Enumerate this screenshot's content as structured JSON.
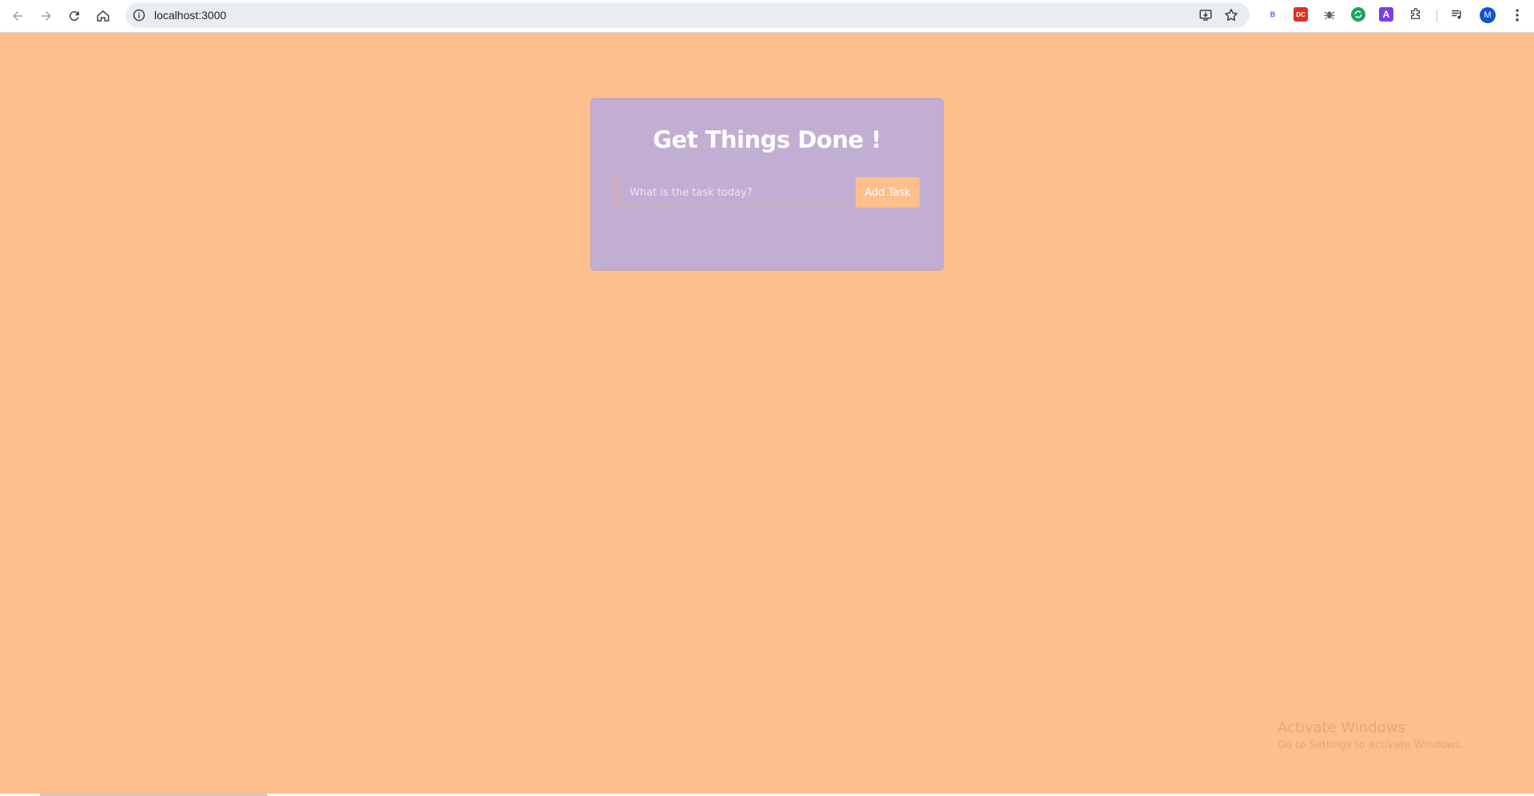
{
  "browser": {
    "url": "localhost:3000",
    "extensions": {
      "b": "B",
      "red": "DC",
      "a": "A"
    },
    "avatar_initial": "M"
  },
  "app": {
    "title": "Get Things Done !",
    "input_placeholder": "What is the task today?",
    "input_value": "",
    "add_button_label": "Add Task"
  },
  "watermark": {
    "title": "Activate Windows",
    "subtitle": "Go to Settings to activate Windows."
  },
  "colors": {
    "page_background": "#fdbf8c",
    "card_background": "#c3aed3",
    "button_background": "#fdbf8c",
    "title_text": "#ffffff"
  }
}
